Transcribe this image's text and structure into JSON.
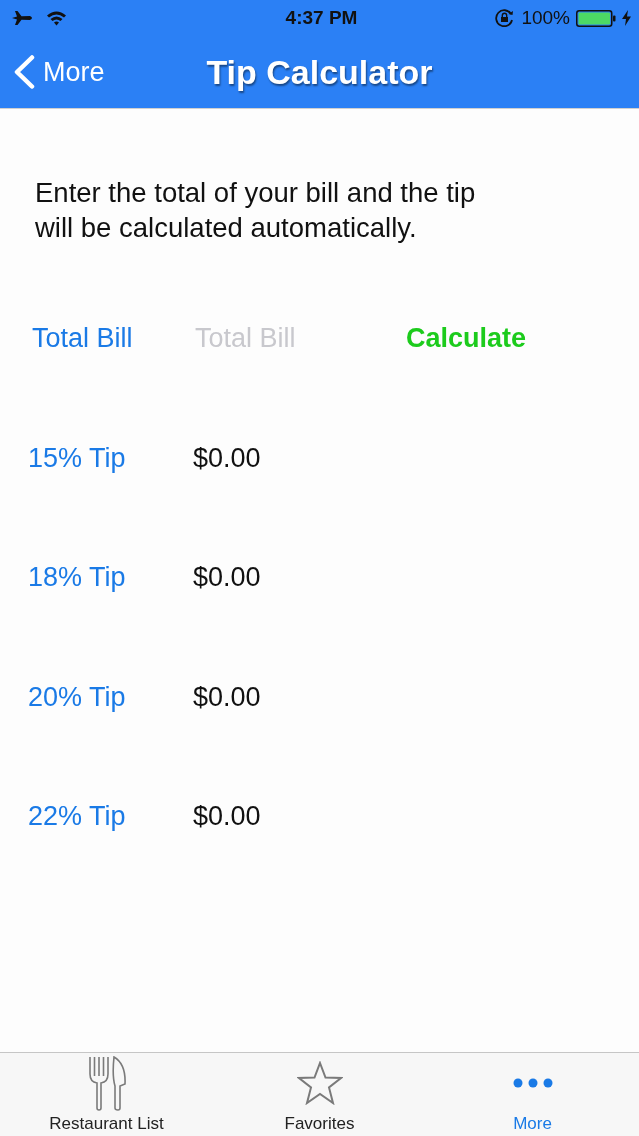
{
  "status_bar": {
    "time": "4:37 PM",
    "battery": "100%"
  },
  "nav_bar": {
    "back": "More",
    "title": "Tip Calculator"
  },
  "intro": "Enter the total of your bill and the tip will be calculated automatically.",
  "bill": {
    "label": "Total Bill",
    "placeholder": "Total Bill",
    "button": "Calculate"
  },
  "tips": [
    {
      "label": "15% Tip",
      "amount": "$0.00"
    },
    {
      "label": "18% Tip",
      "amount": "$0.00"
    },
    {
      "label": "20% Tip",
      "amount": "$0.00"
    },
    {
      "label": "22% Tip",
      "amount": "$0.00"
    }
  ],
  "tab_bar": [
    {
      "label": "Restaurant List",
      "kind": "cutlery",
      "selected": false
    },
    {
      "label": "Favorites",
      "kind": "star",
      "selected": false
    },
    {
      "label": "More",
      "kind": "more",
      "selected": true
    }
  ]
}
